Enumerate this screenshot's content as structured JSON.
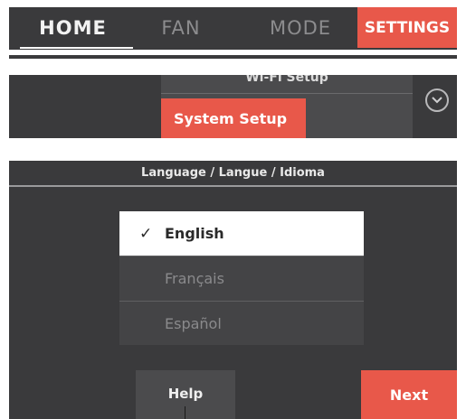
{
  "tabs": {
    "home": "HOME",
    "fan": "FAN",
    "mode": "MODE",
    "settings": "SETTINGS"
  },
  "settings_menu": {
    "partial_item": "Wi-Fi Setup",
    "active_item": "System Setup",
    "scroll_icon": "chevron-down-circle"
  },
  "language_screen": {
    "header": "Language / Langue / Idioma",
    "options": [
      "English",
      "Français",
      "Español"
    ],
    "selected": "English",
    "check_icon": "✓",
    "help_label": "Help",
    "next_label": "Next"
  },
  "colors": {
    "accent": "#e8584a",
    "panel_bg": "#3a3a3c",
    "selected_bg": "#ffffff"
  }
}
